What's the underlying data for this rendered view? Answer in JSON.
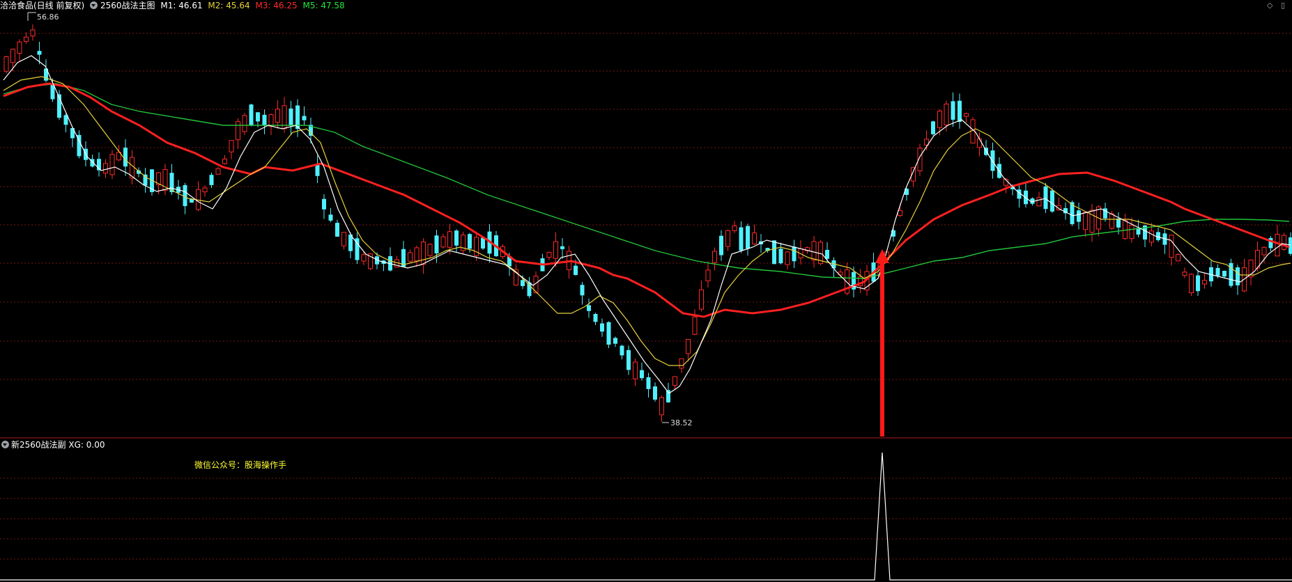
{
  "header": {
    "stock": "洽洽食品(日线 前复权)",
    "indicator": "2560战法主图",
    "m1": "M1: 46.61",
    "m2": "M2: 45.64",
    "m3": "M3: 46.25",
    "m5": "M5: 47.58"
  },
  "colors": {
    "up": "#ff2a2a",
    "down": "#4ff0ff",
    "m1": "#ffffff",
    "m2": "#e6d23c",
    "m3": "#ff2020",
    "m5": "#22c33a",
    "grid": "#7a1515"
  },
  "labels": {
    "high": "56.86",
    "low": "38.52"
  },
  "sub": {
    "title": "新2560战法副",
    "xg": "XG: 0.00",
    "wechat": "微信公众号：股海操作手"
  },
  "icons": [
    "collapse-icon",
    "diamond-icon",
    "window-icon"
  ],
  "chart_data": {
    "type": "candlestick",
    "price_range": [
      38.52,
      56.86
    ],
    "series": [
      {
        "name": "M1",
        "value": 46.61
      },
      {
        "name": "M2",
        "value": 45.64
      },
      {
        "name": "M3",
        "value": 46.25
      },
      {
        "name": "M5",
        "value": 47.58
      }
    ],
    "signal_value": 0.0
  }
}
